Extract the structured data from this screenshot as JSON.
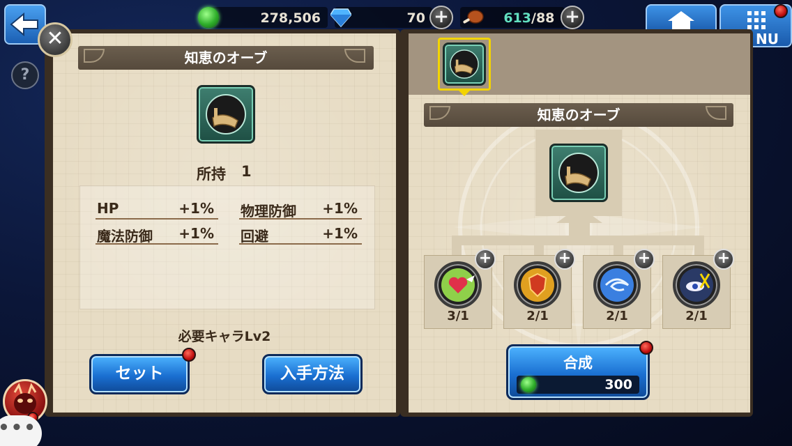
{
  "header": {
    "gold": "278,506",
    "gems": "70",
    "stamina_current": "613",
    "stamina_max": "/88",
    "menu_label": "NU"
  },
  "colors": {
    "stamina_current": "#62e0c0",
    "accent_blue": "#1a6fd1",
    "parchment": "#e7dcc4",
    "selection_yellow": "#f3d400"
  },
  "detail_panel": {
    "title": "知恵のオーブ",
    "owned_label": "所持",
    "owned_count": "1",
    "stats": [
      {
        "name": "HP",
        "value": "+1%"
      },
      {
        "name": "物理防御",
        "value": "+1%"
      },
      {
        "name": "魔法防御",
        "value": "+1%"
      },
      {
        "name": "回避",
        "value": "+1%"
      }
    ],
    "required": "必要キャラLv2",
    "set_button": "セット",
    "obtain_button": "入手方法"
  },
  "craft_panel": {
    "title": "知恵のオーブ",
    "materials": [
      {
        "icon": "winged-heart-orb-icon",
        "count": "3/1"
      },
      {
        "icon": "shield-orb-icon",
        "count": "2/1"
      },
      {
        "icon": "swirl-orb-icon",
        "count": "2/1"
      },
      {
        "icon": "eye-orb-icon",
        "count": "2/1"
      }
    ],
    "combine_button": "合成",
    "combine_cost": "300"
  },
  "icons": {
    "back": "back-arrow-icon",
    "close": "close-icon",
    "help": "help-icon",
    "home": "home-icon",
    "menu": "menu-grid-icon",
    "gold": "green-gem-icon",
    "gem": "blue-diamond-icon",
    "stamina": "meat-icon",
    "oni": "oni-mask-icon",
    "chat": "chat-bubble-icon"
  }
}
